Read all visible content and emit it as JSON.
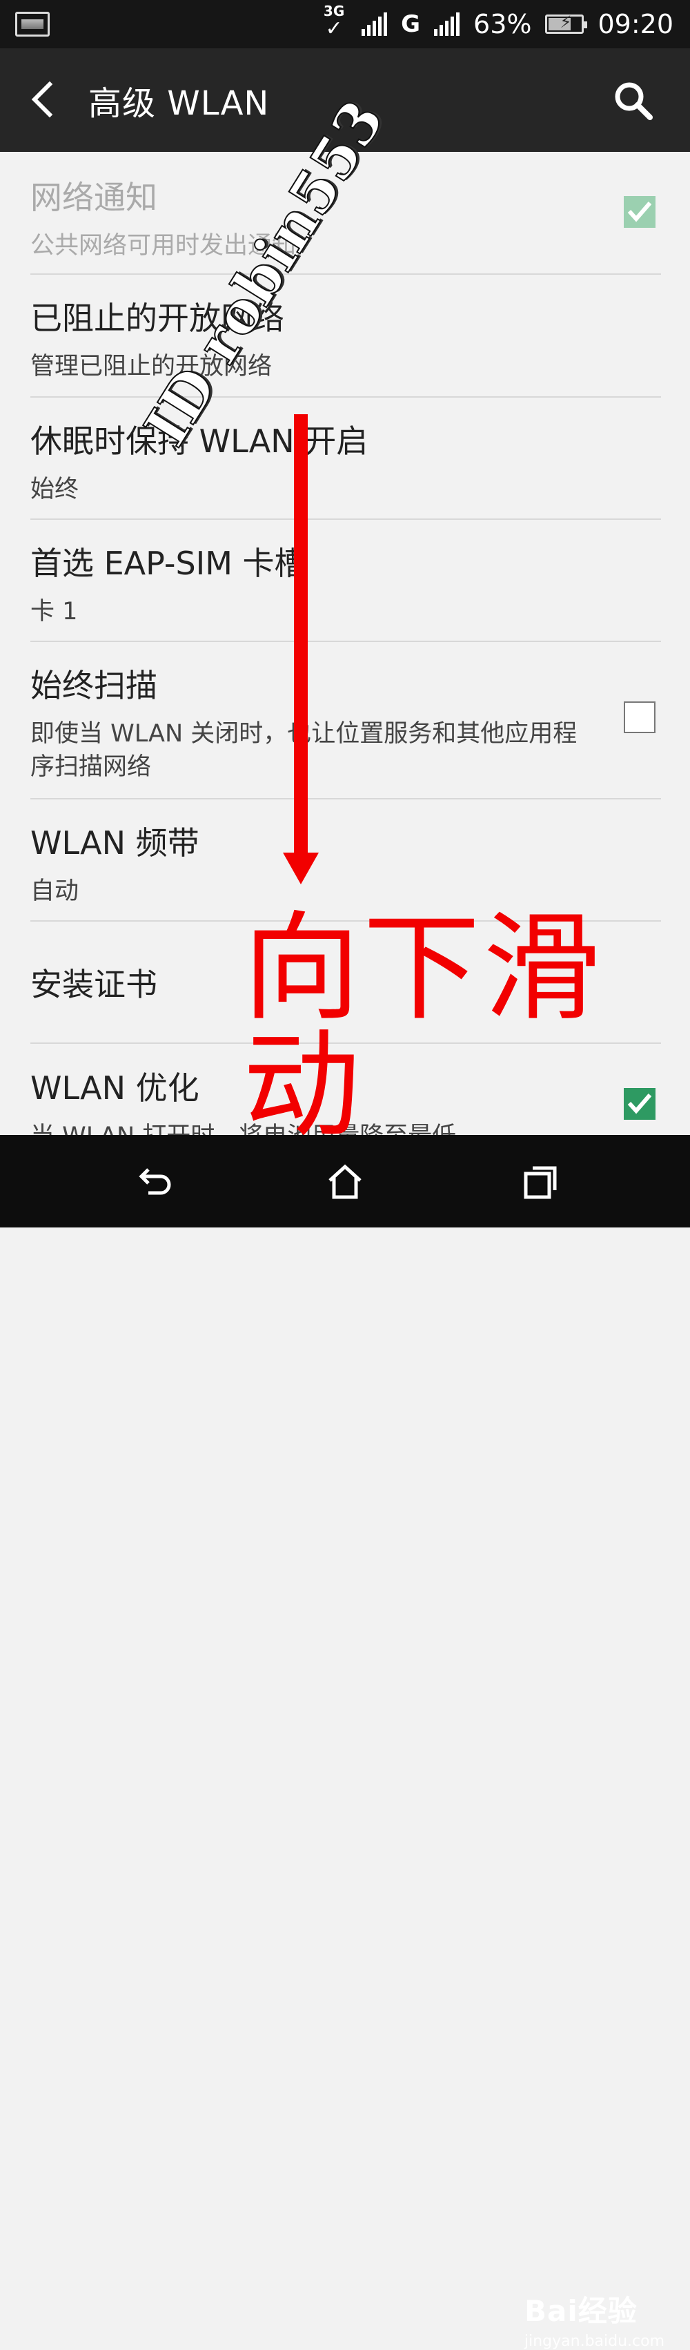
{
  "status_bar": {
    "network_type": "3G",
    "carrier_type": "G",
    "battery": "63%",
    "time": "09:20"
  },
  "action_bar": {
    "title": "高级 WLAN"
  },
  "preferences": [
    {
      "title": "网络通知",
      "summary": "公共网络可用时发出通知",
      "checkbox": "checked",
      "enabled": false
    },
    {
      "title": "已阻止的开放网络",
      "summary": "管理已阻止的开放网络"
    },
    {
      "title": "休眠时保持 WLAN 开启",
      "summary": "始终"
    },
    {
      "title": "首选 EAP-SIM 卡槽",
      "summary": "卡 1"
    },
    {
      "title": "始终扫描",
      "summary": "即使当 WLAN 关闭时，也让位置服务和其他应用程序扫描网络",
      "checkbox": "unchecked"
    },
    {
      "title": "WLAN 频带",
      "summary": "自动"
    },
    {
      "title": "安装证书",
      "summary": ""
    },
    {
      "title": "WLAN 优化",
      "summary": "当 WLAN 打开时，将电池用量降至最低",
      "checkbox": "checked"
    }
  ],
  "overlay": {
    "instruction": "向下滑动",
    "watermark": "ID robin553"
  },
  "branding": {
    "logo": "Bai经验",
    "site": "jingyan.baidu.com"
  },
  "colors": {
    "accent_check": "#2e9a62",
    "annotation_red": "#f20000"
  }
}
